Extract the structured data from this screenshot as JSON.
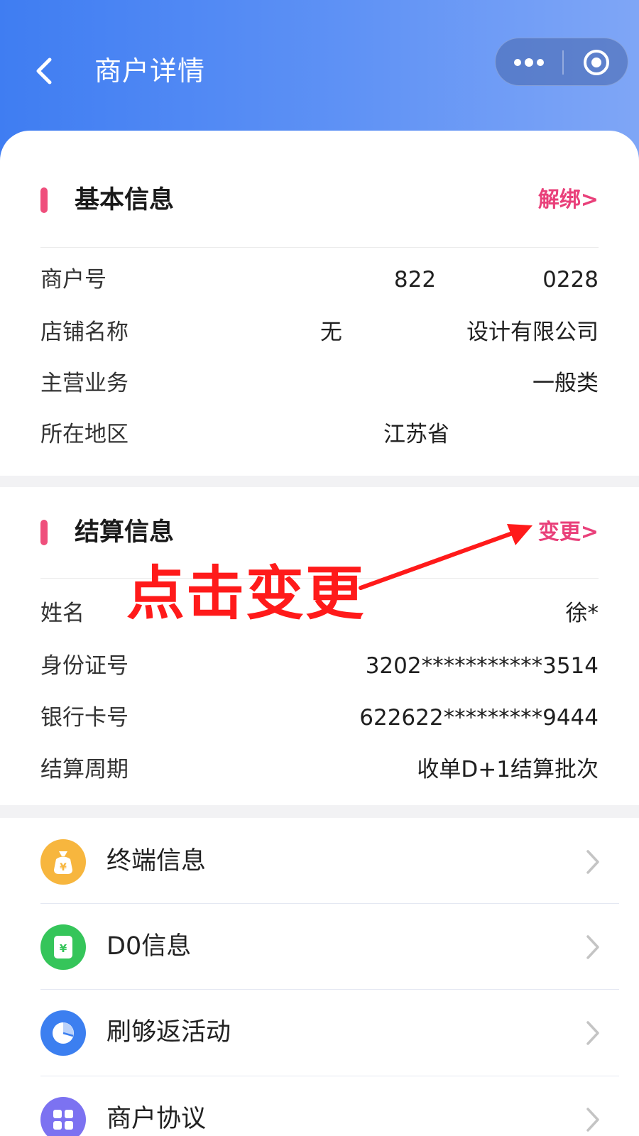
{
  "header": {
    "title": "商户详情",
    "back_icon": "chevron-left-icon",
    "capsule": {
      "more_icon": "more-dots-icon",
      "close_icon": "target-circle-icon"
    }
  },
  "basic_info": {
    "title": "基本信息",
    "action": "解绑>",
    "rows": [
      {
        "label": "商户号",
        "value_start": "822",
        "value_end": "0228"
      },
      {
        "label": "店铺名称",
        "value_start": "无",
        "value_end": "设计有限公司"
      },
      {
        "label": "主营业务",
        "value": "一般类"
      },
      {
        "label": "所在地区",
        "value_start": "江苏省"
      }
    ]
  },
  "settlement_info": {
    "title": "结算信息",
    "action": "变更>",
    "rows": [
      {
        "label": "姓名",
        "value": "徐*"
      },
      {
        "label": "身份证号",
        "value": "3202***********3514"
      },
      {
        "label": "银行卡号",
        "value": "622622*********9444"
      },
      {
        "label": "结算周期",
        "value": "收单D+1结算批次"
      }
    ]
  },
  "annotation": {
    "text": "点击变更",
    "color": "#ff1a1a"
  },
  "menu": [
    {
      "label": "终端信息",
      "icon": "money-bag-icon",
      "color": "#f7b63e"
    },
    {
      "label": "D0信息",
      "icon": "yuan-card-icon",
      "color": "#35c55a"
    },
    {
      "label": "刷够返活动",
      "icon": "pie-chart-icon",
      "color": "#3c7ff0"
    },
    {
      "label": "商户协议",
      "icon": "grid-doc-icon",
      "color": "#7c72f1"
    }
  ],
  "colors": {
    "accent": "#ef4f7c",
    "header_start": "#3f7df2",
    "header_end": "#7fa6f6"
  }
}
